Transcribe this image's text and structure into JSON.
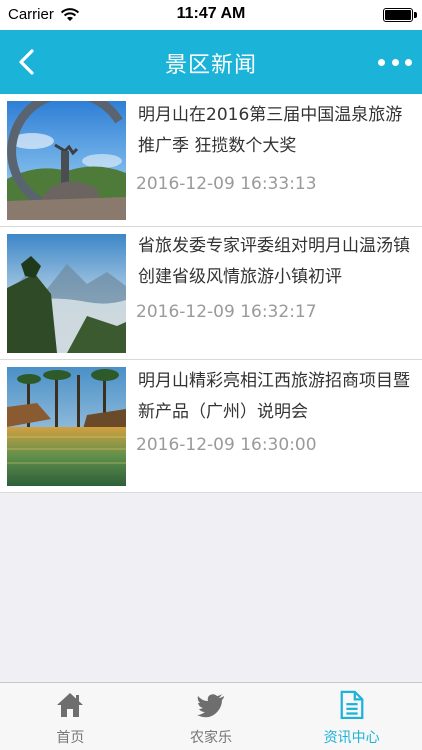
{
  "status_bar": {
    "carrier": "Carrier",
    "time": "11:47 AM",
    "wifi_icon": "wifi-icon",
    "battery_icon": "battery-icon"
  },
  "nav": {
    "title": "景区新闻",
    "back_icon": "chevron-left-icon",
    "more_icon": "more-dots-icon",
    "color": "#1cb3d8"
  },
  "news": [
    {
      "title": "明月山在2016第三届中国温泉旅游推广季 狂揽数个大奖",
      "date": "2016-12-09 16:33:13",
      "thumbnail": "sculpture-photo"
    },
    {
      "title": "省旅发委专家评委组对明月山温汤镇创建省级风情旅游小镇初评",
      "date": "2016-12-09 16:32:17",
      "thumbnail": "mountain-photo"
    },
    {
      "title": "明月山精彩亮相江西旅游招商项目暨新产品（广州）说明会",
      "date": "2016-12-09 16:30:00",
      "thumbnail": "lake-photo"
    }
  ],
  "tabs": [
    {
      "label": "首页",
      "icon": "home-icon",
      "active": false
    },
    {
      "label": "农家乐",
      "icon": "bird-icon",
      "active": false
    },
    {
      "label": "资讯中心",
      "icon": "document-icon",
      "active": true
    }
  ],
  "colors": {
    "accent": "#1cb3d8",
    "title_text": "#333333",
    "date_text": "#9a9a9a",
    "background": "#efeff4"
  }
}
